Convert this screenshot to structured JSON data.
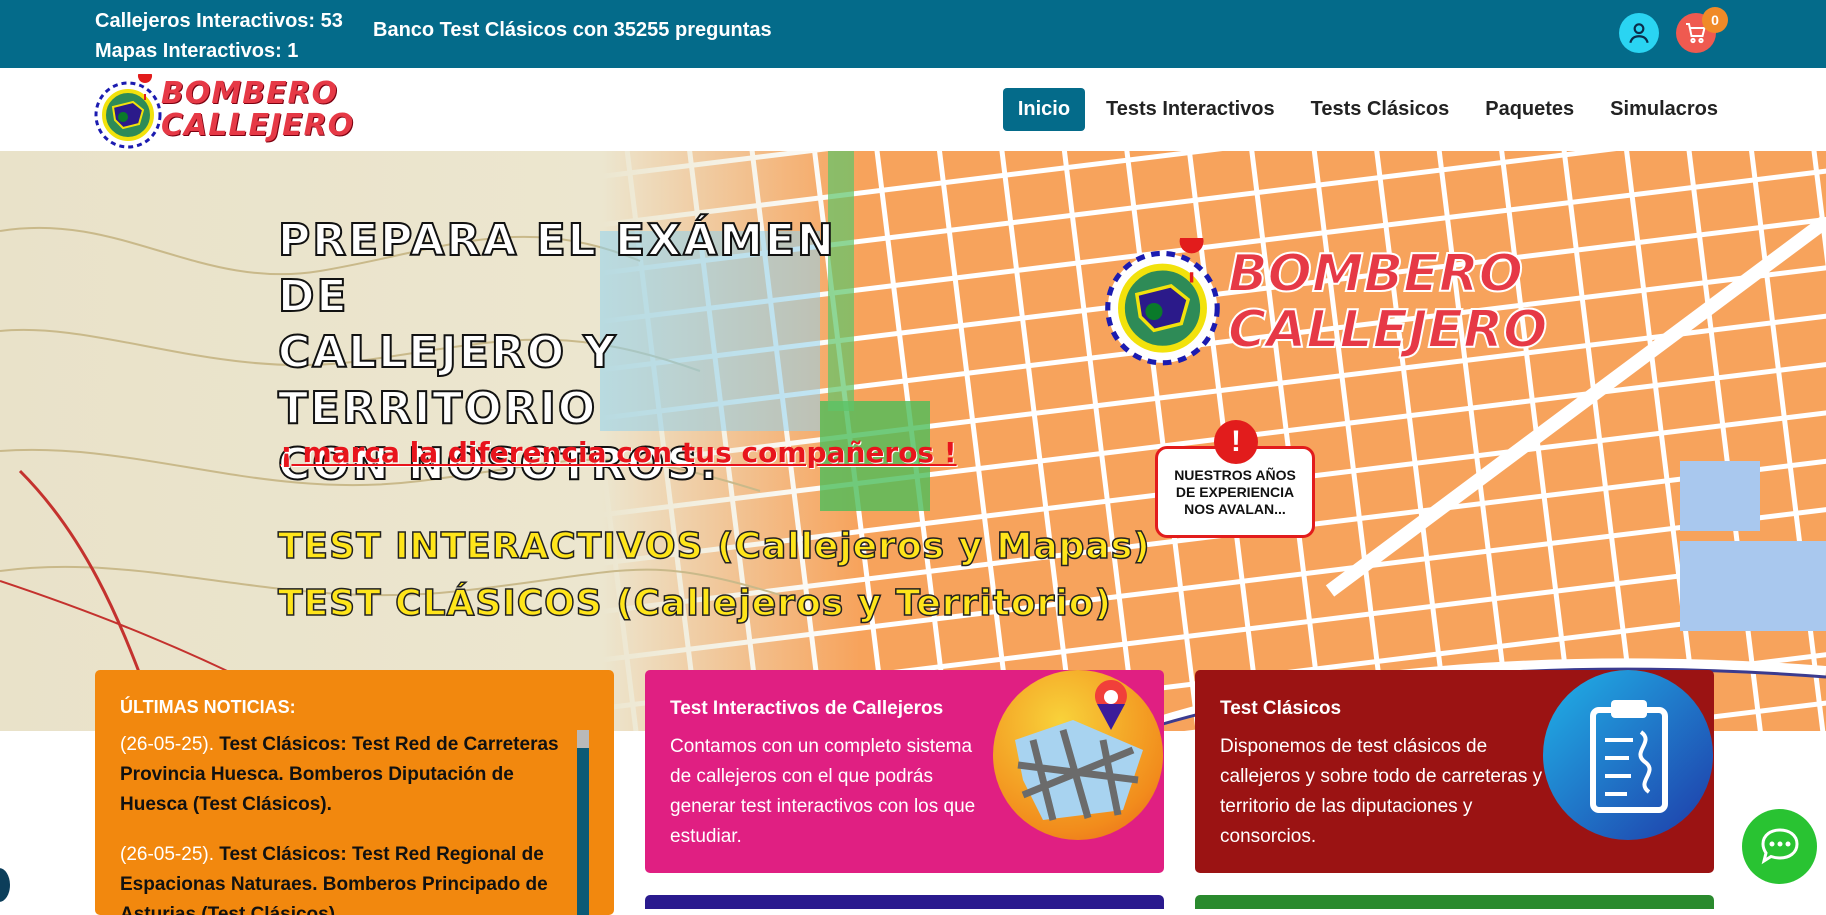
{
  "topbar": {
    "callejeros": "Callejeros Interactivos: 53",
    "mapas": "Mapas Interactivos: 1",
    "banco": "Banco Test Clásicos con 35255 preguntas",
    "cart_count": "0"
  },
  "logo": {
    "line1": "BOMBERO",
    "line2": "CALLEJERO"
  },
  "nav": {
    "items": [
      {
        "label": "Inicio",
        "active": true
      },
      {
        "label": "Tests Interactivos"
      },
      {
        "label": "Tests Clásicos"
      },
      {
        "label": "Paquetes"
      },
      {
        "label": "Simulacros"
      }
    ]
  },
  "hero": {
    "headline_1": "PREPARA EL EXÁMEN DE",
    "headline_2": "CALLEJERO Y TERRITORIO",
    "headline_3": "CON NOSOTROS.",
    "tagline": "¡ marca la diferencia con tus compañeros !",
    "line_interactivos": "TEST INTERACTIVOS (Callejeros y Mapas)",
    "line_clasicos": "TEST CLÁSICOS (Callejeros y Territorio)",
    "logo_line1": "BOMBERO",
    "logo_line2": "CALLEJERO",
    "experience_bang": "!",
    "experience": "NUESTROS AÑOS DE EXPERIENCIA NOS AVALAN..."
  },
  "cards": {
    "news": {
      "title": "ÚLTIMAS NOTICIAS:",
      "items": [
        {
          "date": "(26-05-25).",
          "text": "Test Clásicos: Test Red de Carreteras Provincia Huesca. Bomberos Diputación de Huesca (Test Clásicos)."
        },
        {
          "date": "(26-05-25).",
          "text": "Test Clásicos: Test Red Regional de Espacionas Naturaes. Bomberos Principado de Asturias (Test Clásicos)."
        }
      ]
    },
    "interactivos": {
      "title": "Test Interactivos de Callejeros",
      "body": "Contamos con un completo sistema de callejeros con el que podrás generar test interactivos con los que estudiar."
    },
    "clasicos": {
      "title": "Test Clásicos",
      "body": "Disponemos de test clásicos de callejeros y sobre todo de carreteras y territorio de las diputaciones y consorcios."
    }
  },
  "colors": {
    "topbar": "#046b8a",
    "news": "#f2880e",
    "interactivos": "#e01f82",
    "clasicos": "#9b1313",
    "chat": "#29c332"
  }
}
